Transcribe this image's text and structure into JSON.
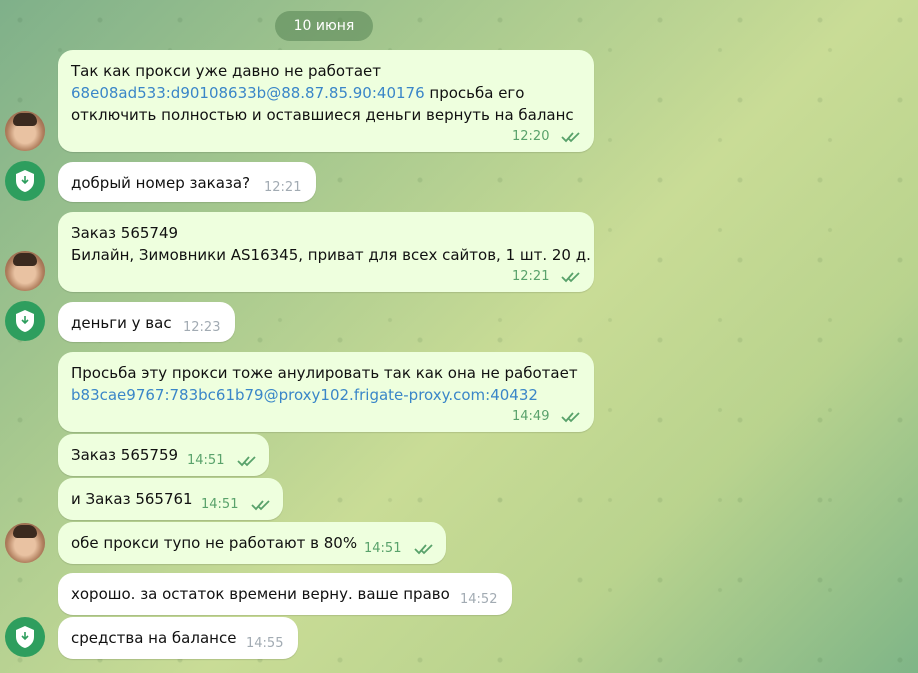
{
  "date_label": "10 июня",
  "colors": {
    "outgoing_bubble": "#eeffde",
    "incoming_bubble": "#ffffff",
    "link": "#3a86c8",
    "time_out": "#59a26b",
    "time_in": "#a2abb3",
    "support_avatar": "#2e9e5e"
  },
  "messages": [
    {
      "lines": [
        "Так как прокси уже давно не работает"
      ],
      "link": "68e08ad533:d90108633b@88.87.85.90:40176",
      "after_link": " просьба его",
      "line3": "отключить полностью и оставшиеся деньги вернуть на баланс",
      "time": "12:20"
    },
    {
      "text": "добрый номер заказа?",
      "time": "12:21"
    },
    {
      "line1": "Заказ 565749",
      "line2": "Билайн, Зимовники AS16345, приват для всех сайтов, 1 шт. 20 д.",
      "time": "12:21"
    },
    {
      "text": "деньги у вас",
      "time": "12:23"
    },
    {
      "line1": "Просьба эту прокси тоже анулировать так как она не работает",
      "link": "b83cae9767:783bc61b79@proxy102.frigate-proxy.com:40432",
      "time": "14:49"
    },
    {
      "text": "Заказ 565759",
      "time": "14:51"
    },
    {
      "text": "и Заказ 565761",
      "time": "14:51"
    },
    {
      "text": "обе прокси тупо не работают в 80%",
      "time": "14:51"
    },
    {
      "text": "хорошо. за остаток времени верну. ваше право",
      "time": "14:52"
    },
    {
      "text": "средства на балансе",
      "time": "14:55"
    }
  ]
}
